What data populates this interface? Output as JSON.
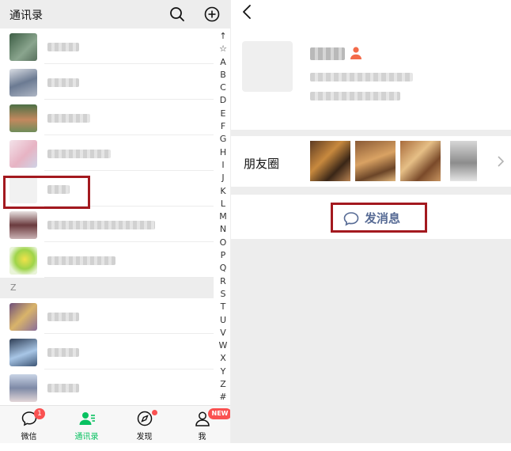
{
  "contacts_header": {
    "title": "通讯录"
  },
  "index_letters": [
    "↑",
    "☆",
    "A",
    "B",
    "C",
    "D",
    "E",
    "F",
    "G",
    "H",
    "I",
    "J",
    "K",
    "L",
    "M",
    "N",
    "O",
    "P",
    "Q",
    "R",
    "S",
    "T",
    "U",
    "V",
    "W",
    "X",
    "Y",
    "Z",
    "#"
  ],
  "section_z": "Z",
  "tabs": [
    {
      "label": "微信",
      "badge": "1",
      "icon": "chat-icon"
    },
    {
      "label": "通讯录",
      "active": true,
      "icon": "contacts-icon"
    },
    {
      "label": "发现",
      "icon": "compass-icon"
    },
    {
      "label": "我",
      "badge": "NEW",
      "icon": "person-icon"
    }
  ],
  "profile": {
    "moments_label": "朋友圈",
    "send_message_label": "发消息"
  },
  "colors": {
    "highlight": "#a3191f",
    "accent": "#07c160",
    "link": "#576b95",
    "badge": "#fa5151"
  }
}
